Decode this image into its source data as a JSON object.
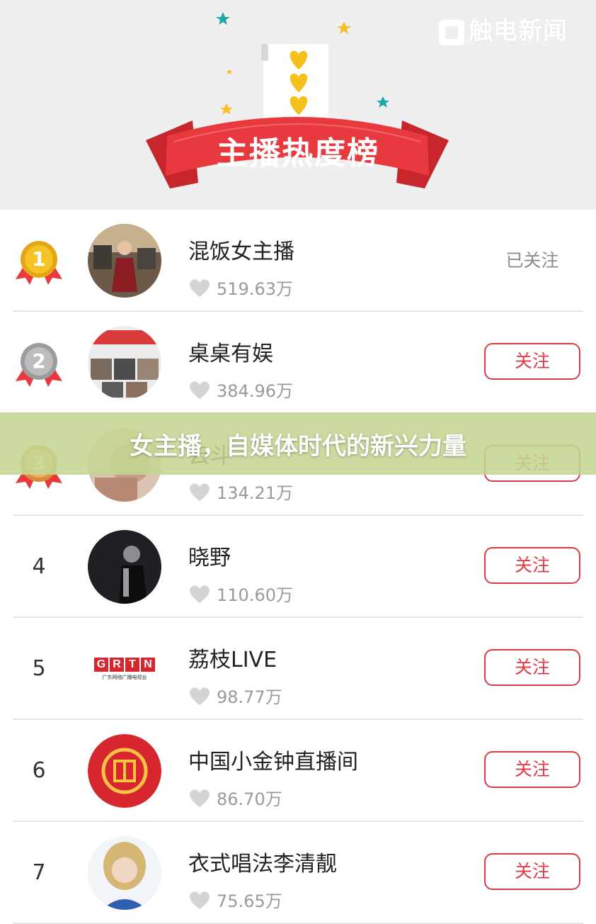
{
  "header": {
    "title": "主播热度榜",
    "watermark": "触电新闻",
    "colors": {
      "ribbon": "#e8393f",
      "star_yellow": "#f7bf2e",
      "star_teal": "#1aa7a8",
      "heart": "#f6c01a"
    }
  },
  "banner": {
    "text": "女主播，自媒体时代的新兴力量"
  },
  "list": [
    {
      "rank": "1",
      "medal": "gold",
      "name": "混饭女主播",
      "likes": "519.63万",
      "button": "已关注",
      "followed": true,
      "avatar": "photo-woman-in-office"
    },
    {
      "rank": "2",
      "medal": "silver",
      "name": "桌桌有娱",
      "likes": "384.96万",
      "button": "关注",
      "followed": false,
      "avatar": "photo-collage"
    },
    {
      "rank": "3",
      "medal": "bronze",
      "name": "云斗",
      "likes": "134.21万",
      "button": "关注",
      "followed": false,
      "avatar": "photo-portrait"
    },
    {
      "rank": "4",
      "medal": "",
      "name": "晓野",
      "likes": "110.60万",
      "button": "关注",
      "followed": false,
      "avatar": "photo-dark-portrait"
    },
    {
      "rank": "5",
      "medal": "",
      "name": "荔枝LIVE",
      "likes": "98.77万",
      "button": "关注",
      "followed": false,
      "avatar": "logo-grtn",
      "avatar_text": "GRTN",
      "avatar_subtext": "广东网络广播电视台"
    },
    {
      "rank": "6",
      "medal": "",
      "name": "中国小金钟直播间",
      "likes": "86.70万",
      "button": "关注",
      "followed": false,
      "avatar": "logo-red-seal"
    },
    {
      "rank": "7",
      "medal": "",
      "name": "衣式唱法李清靓",
      "likes": "75.65万",
      "button": "关注",
      "followed": false,
      "avatar": "photo-blonde-woman"
    }
  ]
}
